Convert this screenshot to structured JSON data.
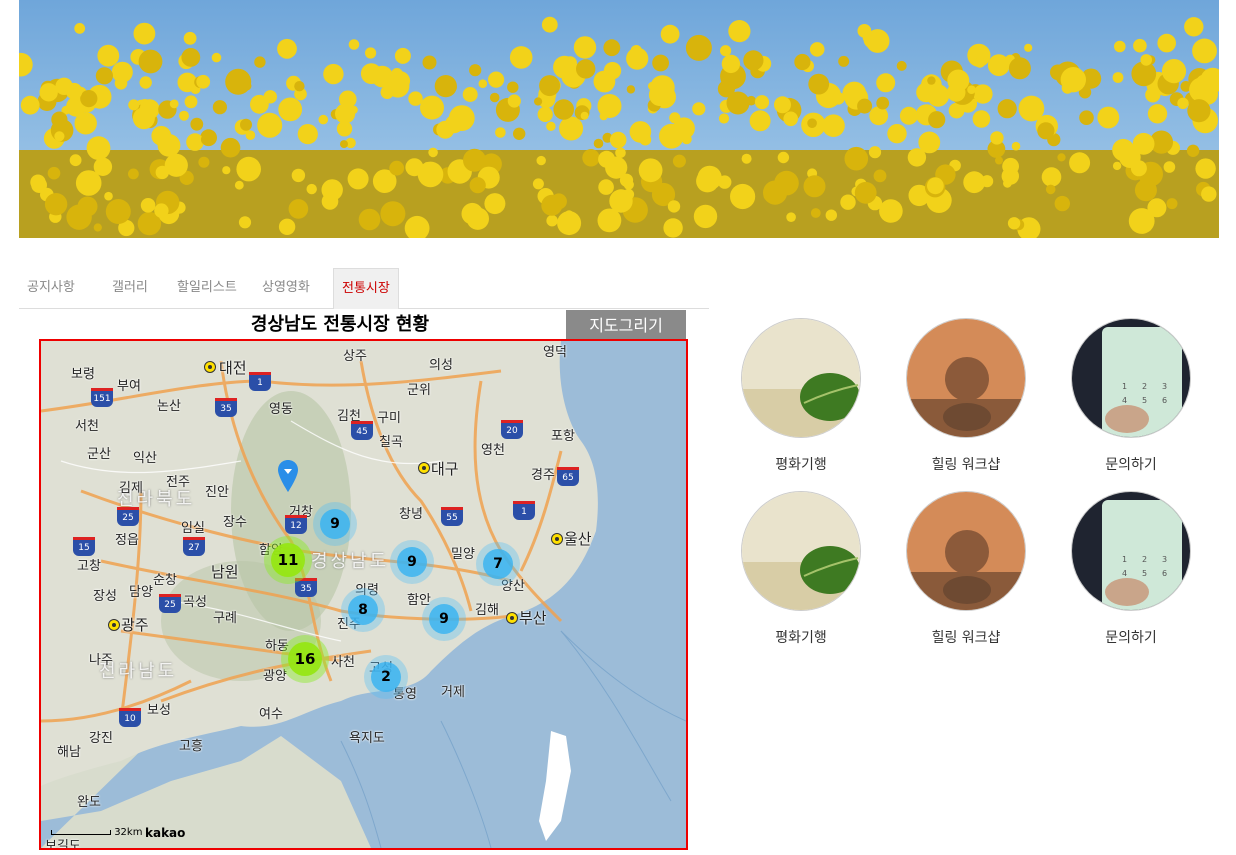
{
  "nav": {
    "tabs": [
      {
        "label": "공지사항"
      },
      {
        "label": "갤러리"
      },
      {
        "label": "할일리스트"
      },
      {
        "label": "상영영화"
      },
      {
        "label": "전통시장",
        "active": true
      }
    ]
  },
  "map_section": {
    "title": "경상남도 전통시장 현황",
    "draw_button": "지도그리기"
  },
  "map": {
    "clusters": [
      {
        "count": "9",
        "kind": "blue"
      },
      {
        "count": "11",
        "kind": "green"
      },
      {
        "count": "9",
        "kind": "blue"
      },
      {
        "count": "7",
        "kind": "blue"
      },
      {
        "count": "8",
        "kind": "blue"
      },
      {
        "count": "9",
        "kind": "blue"
      },
      {
        "count": "16",
        "kind": "green"
      },
      {
        "count": "2",
        "kind": "blue"
      }
    ],
    "regions": [
      "전라북도",
      "경상남도",
      "전라남도"
    ],
    "places": [
      "보령",
      "부여",
      "대전",
      "상주",
      "의성",
      "영덕",
      "논산",
      "영동",
      "군위",
      "김천",
      "구미",
      "포항",
      "서천",
      "칠곡",
      "영천",
      "군산",
      "익산",
      "대구",
      "경주",
      "김제",
      "전주",
      "거창",
      "진안",
      "장수",
      "창녕",
      "울산",
      "정읍",
      "임실",
      "밀양",
      "함양",
      "고창",
      "순창",
      "남원",
      "의령",
      "양산",
      "함안",
      "장성",
      "담양",
      "곡성",
      "광주",
      "구례",
      "김해",
      "부산",
      "진주",
      "나주",
      "하동",
      "사천",
      "고성",
      "광양",
      "통영",
      "거제",
      "보성",
      "여수",
      "강진",
      "고흥",
      "해남",
      "욕지도",
      "완도",
      "보길도"
    ],
    "highways": [
      "151",
      "1",
      "35",
      "45",
      "20",
      "65",
      "25",
      "12",
      "55",
      "1",
      "15",
      "27",
      "35",
      "25",
      "10"
    ],
    "scale_label": "32km",
    "logo": "kakao"
  },
  "menu_cards": [
    {
      "label": "평화기행",
      "icon": "leaf-photo"
    },
    {
      "label": "힐링 워크샵",
      "icon": "stones-photo"
    },
    {
      "label": "문의하기",
      "icon": "phone-photo"
    },
    {
      "label": "평화기행",
      "icon": "leaf-photo"
    },
    {
      "label": "힐링 워크샵",
      "icon": "stones-photo"
    },
    {
      "label": "문의하기",
      "icon": "phone-photo"
    }
  ]
}
